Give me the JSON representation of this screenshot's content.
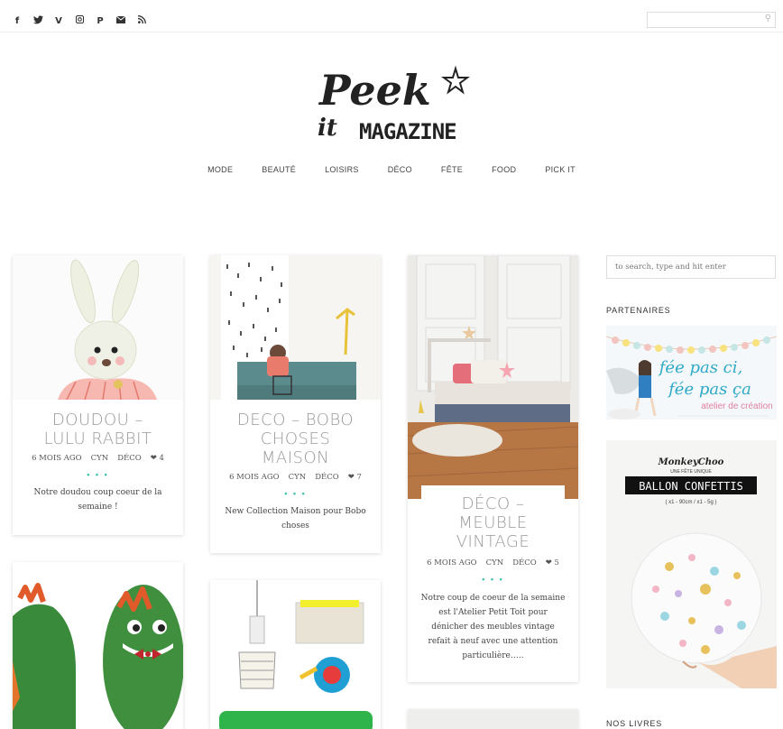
{
  "social_icons": [
    "facebook-icon",
    "twitter-icon",
    "vimeo-icon",
    "instagram-icon",
    "pinterest-icon",
    "email-icon",
    "rss-icon"
  ],
  "top_search": {
    "placeholder": ""
  },
  "logo": {
    "line1": "Peek",
    "line2": "it",
    "line3": "MAGAZINE"
  },
  "nav": [
    "MODE",
    "BEAUTÉ",
    "LOISIRS",
    "DÉCO",
    "FÊTE",
    "FOOD",
    "PICK IT"
  ],
  "posts": [
    {
      "title": "DOUDOU – LULU RABBIT",
      "title_lines": [
        "DOUDOU –",
        "LULU RABBIT"
      ],
      "date": "6 MOIS AGO",
      "author": "CYN",
      "category": "DÉCO",
      "likes": "4",
      "excerpt_lines": [
        "Notre doudou coup coeur de la",
        "semaine !"
      ]
    },
    {
      "title": "DECO – BOBO CHOSES MAISON",
      "title_lines": [
        "DECO – BOBO",
        "CHOSES",
        "MAISON"
      ],
      "date": "6 MOIS AGO",
      "author": "CYN",
      "category": "DÉCO",
      "likes": "7",
      "excerpt_lines": [
        "New Collection Maison pour Bobo",
        "choses"
      ]
    },
    {
      "title": "DÉCO – MEUBLE VINTAGE",
      "title_lines": [
        "DÉCO –",
        "MEUBLE",
        "VINTAGE"
      ],
      "date": "6 MOIS AGO",
      "author": "CYN",
      "category": "DÉCO",
      "likes": "5",
      "excerpt_lines": [
        "Notre coup de coeur de la semaine",
        "est l'Atelier Petit Toit pour",
        "dénicher des meubles vintage",
        "refait à neuf avec une attention",
        "particulière….."
      ]
    }
  ],
  "dots": "• • •",
  "sidebar": {
    "search_placeholder": "to search, type and hit enter",
    "partenaires_title": "PARTENAIRES",
    "ad1": {
      "line1": "fée pas ci,",
      "line2": "fée pas ça",
      "line3": "atelier de création"
    },
    "ad2": {
      "brand": "MonkeyChoo",
      "tagline": "UNE FÊTE UNIQUE",
      "banner": "BALLON CONFETTIS",
      "sizes": "( x1 - 90cm / x1 - 5g )"
    },
    "livres_title": "NOS LIVRES"
  },
  "colors": {
    "accent": "#3cc1b0",
    "title_grey": "#999999"
  }
}
